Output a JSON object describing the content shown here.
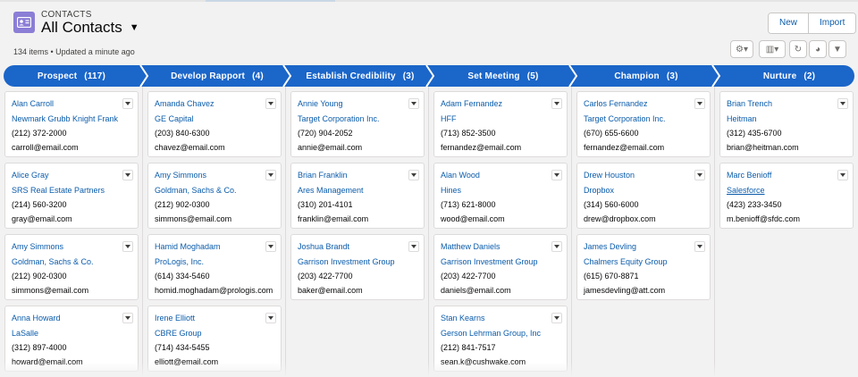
{
  "header": {
    "object_label": "CONTACTS",
    "list_title": "All Contacts",
    "meta": "134 items • Updated a minute ago",
    "icon": "contact-card-icon",
    "buttons": {
      "new": "New",
      "import": "Import"
    },
    "tools": [
      "gear-icon",
      "table-icon",
      "refresh-icon",
      "chart-icon",
      "filter-icon"
    ]
  },
  "colors": {
    "path": "#1b66c9",
    "link": "#0b5cab",
    "icon": "#8b7ed6"
  },
  "stages": [
    {
      "label": "Prospect",
      "count": "(117)"
    },
    {
      "label": "Develop Rapport",
      "count": "(4)"
    },
    {
      "label": "Establish Credibility",
      "count": "(3)"
    },
    {
      "label": "Set Meeting",
      "count": "(5)"
    },
    {
      "label": "Champion",
      "count": "(3)"
    },
    {
      "label": "Nurture",
      "count": "(2)"
    }
  ],
  "columns": [
    [
      {
        "name": "Alan Carroll",
        "company": "Newmark Grubb Knight Frank",
        "phone": "(212) 372-2000",
        "email": "carroll@email.com"
      },
      {
        "name": "Alice Gray",
        "company": "SRS Real Estate Partners",
        "phone": "(214) 560-3200",
        "email": "gray@email.com"
      },
      {
        "name": "Amy Simmons",
        "company": "Goldman, Sachs & Co.",
        "phone": "(212) 902-0300",
        "email": "simmons@email.com"
      },
      {
        "name": "Anna Howard",
        "company": "LaSalle",
        "phone": "(312) 897-4000",
        "email": "howard@email.com"
      }
    ],
    [
      {
        "name": "Amanda Chavez",
        "company": "GE Capital",
        "phone": "(203) 840-6300",
        "email": "chavez@email.com"
      },
      {
        "name": "Amy Simmons",
        "company": "Goldman, Sachs & Co.",
        "phone": "(212) 902-0300",
        "email": "simmons@email.com"
      },
      {
        "name": "Hamid Moghadam",
        "company": "ProLogis, Inc.",
        "phone": "(614) 334-5460",
        "email": "homid.moghadam@prologis.com"
      },
      {
        "name": "Irene Elliott",
        "company": "CBRE Group",
        "phone": "(714) 434-5455",
        "email": "elliott@email.com"
      }
    ],
    [
      {
        "name": "Annie Young",
        "company": "Target Corporation Inc.",
        "phone": "(720) 904-2052",
        "email": "annie@email.com"
      },
      {
        "name": "Brian Franklin",
        "company": "Ares Management",
        "phone": "(310) 201-4101",
        "email": "franklin@email.com"
      },
      {
        "name": "Joshua Brandt",
        "company": "Garrison Investment Group",
        "phone": "(203) 422-7700",
        "email": "baker@email.com"
      }
    ],
    [
      {
        "name": "Adam Fernandez",
        "company": "HFF",
        "phone": "(713) 852-3500",
        "email": "fernandez@email.com"
      },
      {
        "name": "Alan Wood",
        "company": "Hines",
        "phone": "(713) 621-8000",
        "email": "wood@email.com"
      },
      {
        "name": "Matthew Daniels",
        "company": "Garrison Investment Group",
        "phone": "(203) 422-7700",
        "email": "daniels@email.com"
      },
      {
        "name": "Stan Kearns",
        "company": "Gerson Lehrman Group, Inc",
        "phone": "(212) 841-7517",
        "email": "sean.k@cushwake.com"
      }
    ],
    [
      {
        "name": "Carlos Fernandez",
        "company": "Target Corporation Inc.",
        "phone": "(670) 655-6600",
        "email": "fernandez@email.com"
      },
      {
        "name": "Drew Houston",
        "company": "Dropbox",
        "phone": "(314) 560-6000",
        "email": "drew@dropbox.com"
      },
      {
        "name": "James Devling",
        "company": "Chalmers Equity Group",
        "phone": "(615) 670-8871",
        "email": "jamesdevling@att.com"
      }
    ],
    [
      {
        "name": "Brian Trench",
        "company": "Heitman",
        "phone": "(312) 435-6700",
        "email": "brian@heitman.com"
      },
      {
        "name": "Marc Benioff",
        "company": "Salesforce",
        "phone": "(423) 233-3450",
        "email": "m.benioff@sfdc.com"
      }
    ]
  ]
}
